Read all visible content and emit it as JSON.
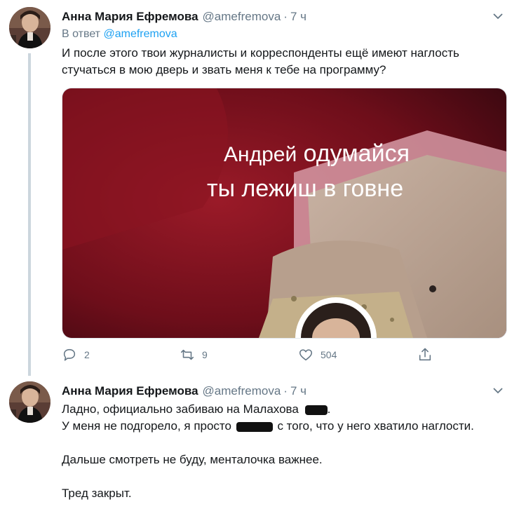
{
  "tweet1": {
    "name": "Анна Мария Ефремова",
    "handle": "@amefremova",
    "dot": "·",
    "time": "7 ч",
    "reply_prefix": "В ответ",
    "reply_handle": "@amefremova",
    "text_line1": "И после этого твои журналисты и корреспонденты ещё имеют наглость",
    "text_line2": "стучаться в мою дверь и звать меня к тебе на программу?",
    "media_caption_1a": "Андрей",
    "media_caption_1b": "одумайся",
    "media_caption_2": "ты лежиш в говне",
    "replies": "2",
    "retweets": "9",
    "likes": "504"
  },
  "tweet2": {
    "name": "Анна Мария Ефремова",
    "handle": "@amefremova",
    "dot": "·",
    "time": "7 ч",
    "line1": "Ладно, официально забиваю на Малахова",
    "line1_end": ".",
    "line2_start": "У меня не подгорело, я просто",
    "line2_end": "с того, что у него хватило наглости.",
    "line3": "Дальше смотреть не буду, менталочка важнее.",
    "line4": "Тред закрыт."
  },
  "icons": {
    "reply": "reply-icon",
    "retweet": "retweet-icon",
    "like": "heart-icon",
    "share": "share-icon",
    "menu": "chevron-down-icon"
  },
  "colors": {
    "link": "#1da1f2",
    "muted": "#657786",
    "text": "#14171a",
    "thread_line": "#ccd6dd"
  }
}
